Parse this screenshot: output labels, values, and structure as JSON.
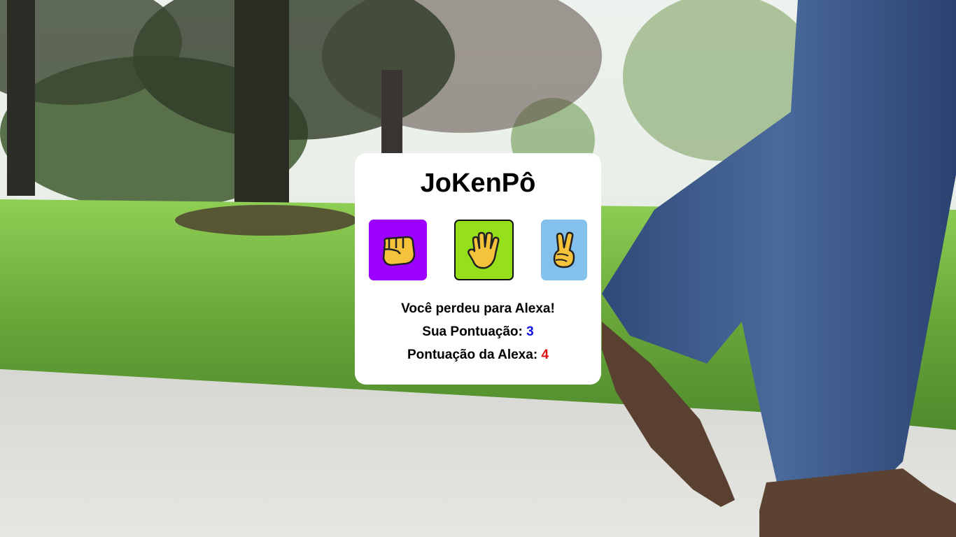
{
  "game": {
    "title": "JoKenPô"
  },
  "choices": [
    {
      "name": "rock",
      "icon": "fist-icon",
      "color": "#9c00ff"
    },
    {
      "name": "paper",
      "icon": "open-hand-icon",
      "color": "#95e01a",
      "selected": true
    },
    {
      "name": "scissors",
      "icon": "victory-hand-icon",
      "color": "#84c0ec"
    }
  ],
  "result": {
    "message": "Você perdeu para Alexa!",
    "player_label": "Sua Pontuação:",
    "player_score": "3",
    "cpu_label": "Pontuação da Alexa:",
    "cpu_score": "4"
  },
  "colors": {
    "player_score": "#1010e0",
    "cpu_score": "#e01010",
    "card_bg": "#ffffff"
  }
}
